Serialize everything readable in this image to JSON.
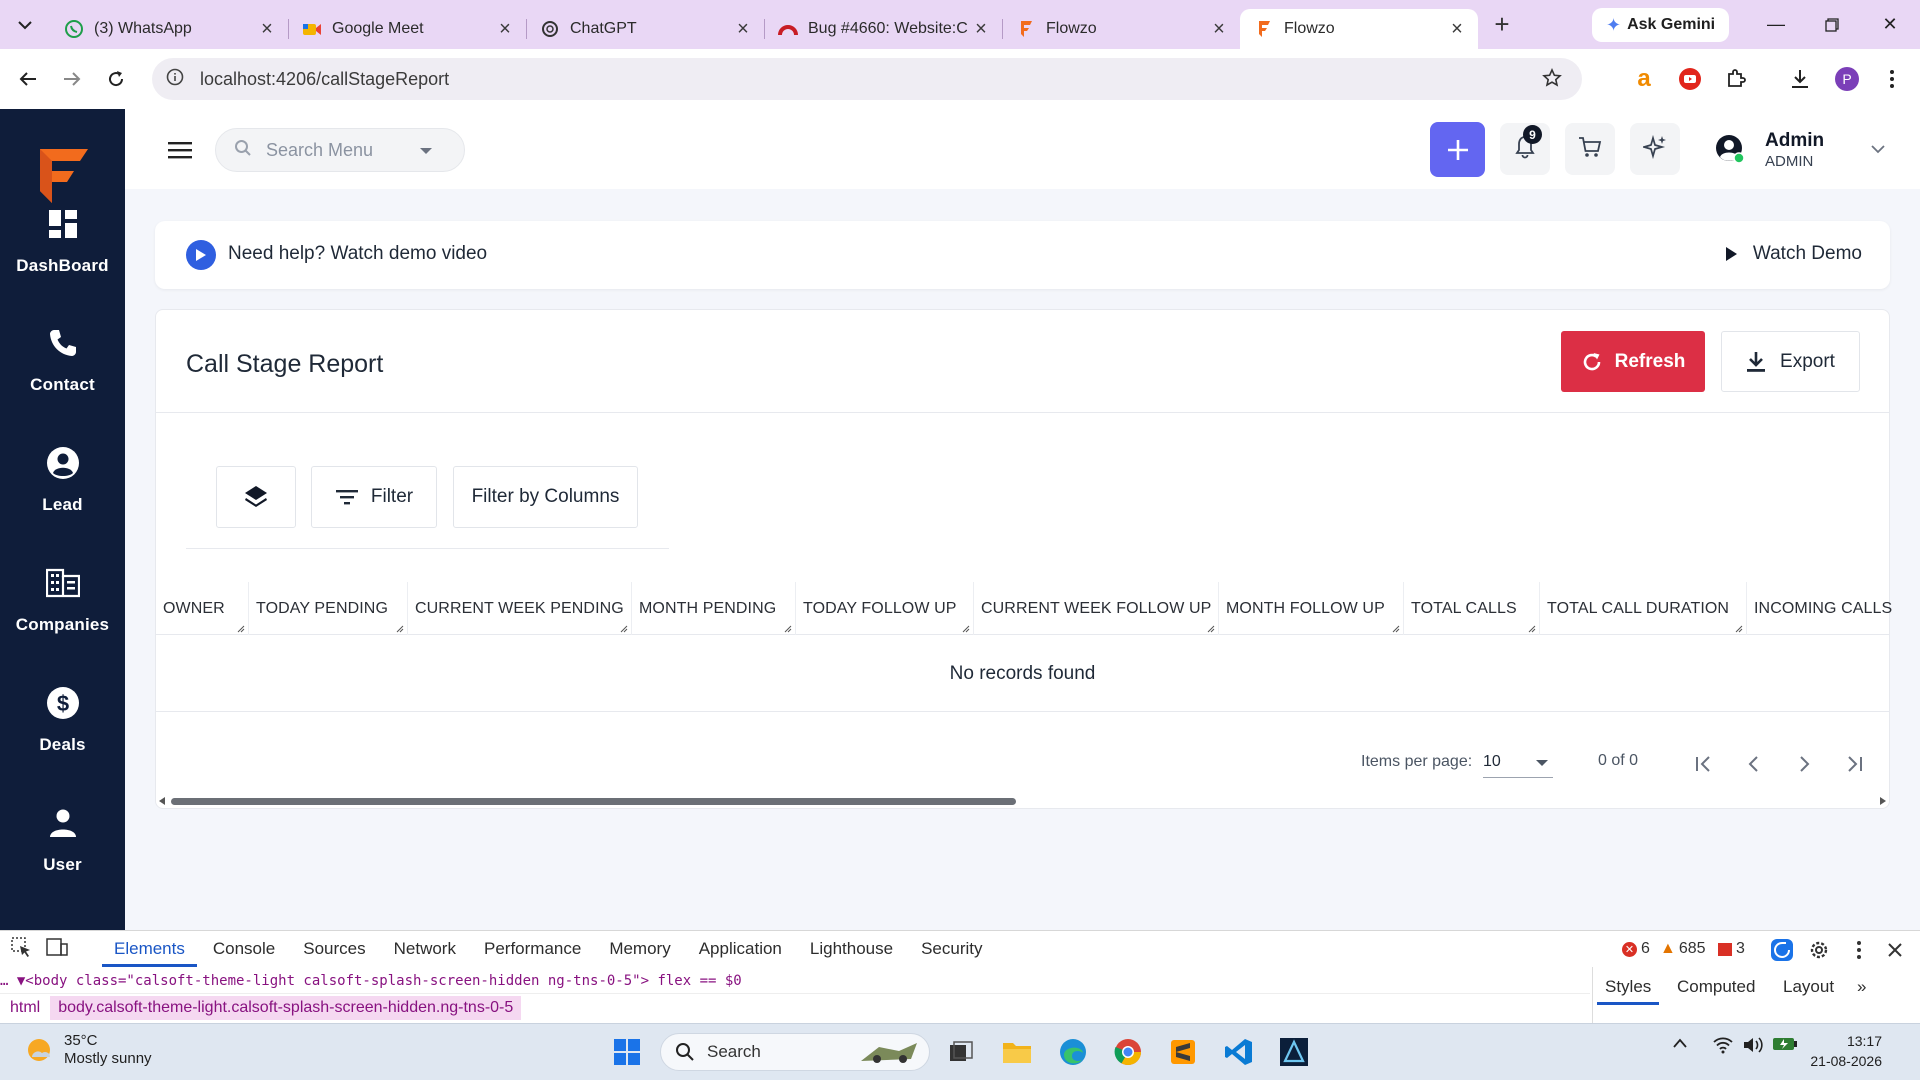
{
  "browser": {
    "tabs": [
      {
        "title": "(3) WhatsApp",
        "icon": "whatsapp-icon"
      },
      {
        "title": "Google Meet",
        "icon": "meet-icon"
      },
      {
        "title": "ChatGPT",
        "icon": "chatgpt-icon"
      },
      {
        "title": "Bug #4660: Website:C",
        "icon": "redmine-icon"
      },
      {
        "title": "Flowzo",
        "icon": "flowzo-icon"
      },
      {
        "title": "Flowzo",
        "icon": "flowzo-icon",
        "active": true
      }
    ],
    "gemini_label": "Ask Gemini",
    "url": "localhost:4206/callStageReport",
    "profile_initial": "P"
  },
  "sidebar": {
    "items": [
      {
        "label": "DashBoard",
        "icon": "dashboard-icon"
      },
      {
        "label": "Contact",
        "icon": "phone-icon"
      },
      {
        "label": "Lead",
        "icon": "lead-icon"
      },
      {
        "label": "Companies",
        "icon": "companies-icon"
      },
      {
        "label": "Deals",
        "icon": "dollar-icon"
      },
      {
        "label": "User",
        "icon": "user-icon"
      }
    ]
  },
  "header": {
    "search_placeholder": "Search Menu",
    "notification_count": "9",
    "user_name": "Admin",
    "user_role": "ADMIN"
  },
  "help": {
    "text": "Need help? Watch demo video",
    "watch_label": "Watch Demo"
  },
  "report": {
    "title": "Call Stage Report",
    "refresh_label": "Refresh",
    "export_label": "Export",
    "filter_label": "Filter",
    "filter_columns_label": "Filter by Columns",
    "columns": [
      "OWNER",
      "TODAY PENDING",
      "CURRENT WEEK PENDING",
      "MONTH PENDING",
      "TODAY FOLLOW UP",
      "CURRENT WEEK FOLLOW UP",
      "MONTH FOLLOW UP",
      "TOTAL CALLS",
      "TOTAL CALL DURATION",
      "INCOMING CALLS"
    ],
    "empty_text": "No records found",
    "items_per_page_label": "Items per page:",
    "items_per_page": "10",
    "range": "0 of 0"
  },
  "devtools": {
    "tabs": [
      "Elements",
      "Console",
      "Sources",
      "Network",
      "Performance",
      "Memory",
      "Application",
      "Lighthouse",
      "Security"
    ],
    "errors": "6",
    "warnings": "685",
    "issues": "3",
    "dom_line": "… ▼<body class=\"calsoft-theme-light calsoft-splash-screen-hidden ng-tns-0-5\"> flex == $0",
    "crumb_html": "html",
    "crumb_body": "body.calsoft-theme-light.calsoft-splash-screen-hidden.ng-tns-0-5",
    "side_tabs": [
      "Styles",
      "Computed",
      "Layout"
    ]
  },
  "taskbar": {
    "temperature": "35°C",
    "weather": "Mostly sunny",
    "search_label": "Search",
    "time": "13:17",
    "date": "21-08-2026"
  },
  "colors": {
    "sidebar_bg": "#0f1d3a",
    "brand_orange": "#f26b1d",
    "accent_purple": "#6366f1",
    "refresh_red": "#dc2f45",
    "help_blue": "#2f5fe0"
  }
}
